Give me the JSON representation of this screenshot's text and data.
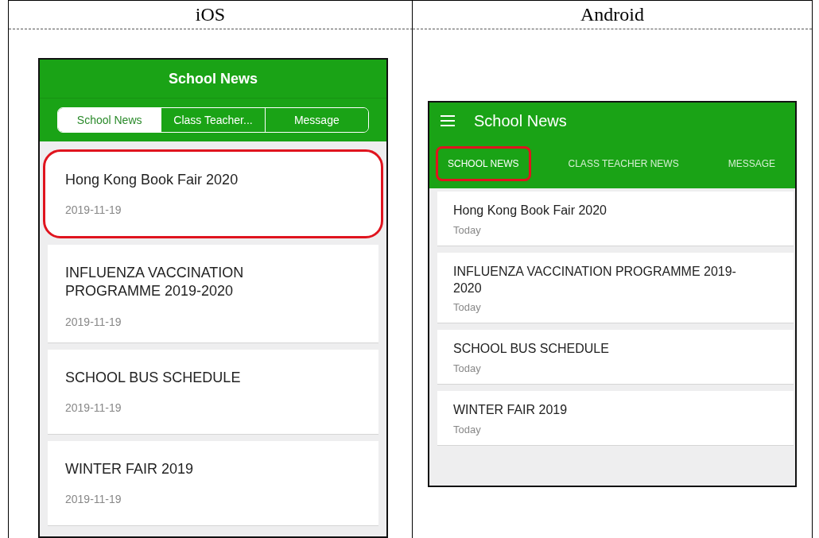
{
  "table": {
    "columns": [
      {
        "heading": "iOS",
        "phone": {
          "kind": "ios",
          "title": "School News",
          "tabs": [
            {
              "label": "School News",
              "selected": true,
              "highlighted": false
            },
            {
              "label": "Class Teacher...",
              "selected": false,
              "highlighted": false
            },
            {
              "label": "Message",
              "selected": false,
              "highlighted": false
            }
          ],
          "items": [
            {
              "title": "Hong Kong Book Fair 2020",
              "date": "2019-11-19",
              "highlighted": true
            },
            {
              "title": "INFLUENZA VACCINATION PROGRAMME 2019-2020",
              "date": "2019-11-19",
              "highlighted": false
            },
            {
              "title": "SCHOOL BUS SCHEDULE",
              "date": "2019-11-19",
              "highlighted": false
            },
            {
              "title": "WINTER FAIR 2019",
              "date": "2019-11-19",
              "highlighted": false
            }
          ]
        }
      },
      {
        "heading": "Android",
        "phone": {
          "kind": "android",
          "title": "School News",
          "tabs": [
            {
              "label": "SCHOOL NEWS",
              "selected": true,
              "highlighted": true
            },
            {
              "label": "CLASS TEACHER NEWS",
              "selected": false,
              "highlighted": false
            },
            {
              "label": "MESSAGE",
              "selected": false,
              "highlighted": false
            }
          ],
          "items": [
            {
              "title": "Hong Kong Book Fair 2020",
              "date": "Today",
              "highlighted": false
            },
            {
              "title": "INFLUENZA VACCINATION PROGRAMME 2019-2020",
              "date": "Today",
              "highlighted": false
            },
            {
              "title": "SCHOOL BUS SCHEDULE",
              "date": "Today",
              "highlighted": false
            },
            {
              "title": "WINTER FAIR 2019",
              "date": "Today",
              "highlighted": false
            }
          ]
        }
      }
    ]
  }
}
